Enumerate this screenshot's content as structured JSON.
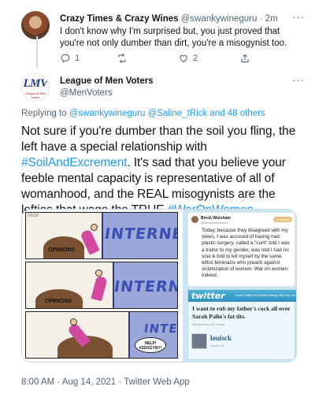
{
  "reply": {
    "name": "Crazy Times & Crazy Wines",
    "handle": "@swankywineguru",
    "separator": " · ",
    "time": "2m",
    "more": "···",
    "text": "I don't know why I'm surprised but, you just proved that you're not only dumber than dirt, you're a misogynist too.",
    "actions": {
      "replies": "1",
      "retweets": "",
      "likes": "2"
    }
  },
  "main_tweet": {
    "name": "League of Men Voters",
    "handle": "@MenVoters",
    "more": "···",
    "avatar_logo": "LMV",
    "avatar_sub": "League of Men Voters",
    "replying_prefix": "Replying to ",
    "replying_to": "@swankywineguru @Saline_tRick and 48 others",
    "body_part1": "Not sure if you're dumber than the soil you fling, the left have a special relationship with ",
    "hashtag1": "#SoilAndExcrement",
    "body_part2": ".  It's sad that you believe your feeble mental capacity is representative of all of womanhood, and the REAL misogynists are the lefties that wage the TRUE ",
    "hashtag2": "#WarOnWomen",
    "body_part3": ".",
    "timestamp": "8:00 AM · Aug 14, 2021 · Twitter Web App"
  },
  "media": {
    "comic": {
      "panel_number": "1/5/20",
      "wall_text": "INTERNET",
      "pile_label": "OPINIONS",
      "help_text": "HELP! #2SOGYNY!"
    },
    "screenshot": {
      "fb_name": "Breck Worsham",
      "fb_handle": "@BreckinWorsham",
      "fb_follow": "Following",
      "fb_text": "Today, because they disagreed with my views, I was accused of having had plastic surgery, called a \"cunt\" told I was a traitor to my gender, was told I had no soul & told to kill myself by the same leftist feminazis who preach against victimization of women. War on women indeed.",
      "tw_logo": "twitter",
      "tw_nav": "Home  Profile  Find People  Settings  Help  Sign out",
      "tw_text": "I want to rub my father's cock all over Sarah Palin's fat tits.",
      "tw_small": "Retweeted by 100+ people",
      "tw_user": "louisck",
      "tw_user_sub": "Louis C.K."
    }
  },
  "colors": {
    "link": "#1d9bf0",
    "muted": "#536471",
    "text": "#0f1419"
  }
}
